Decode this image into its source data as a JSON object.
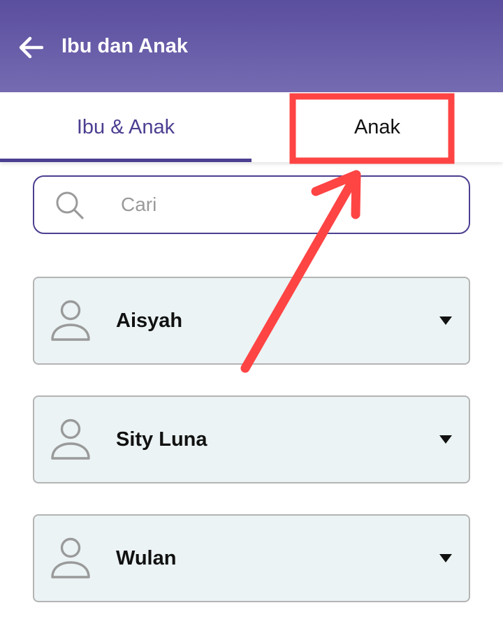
{
  "appbar": {
    "title": "Ibu dan Anak",
    "back_icon": "arrow-left-icon",
    "background": "#5a4e9e",
    "text_color": "#ffffff"
  },
  "tabs": [
    {
      "label": "Ibu & Anak",
      "selected": true
    },
    {
      "label": "Anak",
      "selected": false
    }
  ],
  "search": {
    "placeholder": "Cari",
    "value": "",
    "icon": "search-icon"
  },
  "items": [
    {
      "name": "Aisyah",
      "icon": "person-icon",
      "action_icon": "caret-down-icon"
    },
    {
      "name": "Sity Luna",
      "icon": "person-icon",
      "action_icon": "caret-down-icon"
    },
    {
      "name": "Wulan",
      "icon": "person-icon",
      "action_icon": "caret-down-icon"
    }
  ],
  "colors": {
    "accent": "#4b3f91",
    "card_background": "#ebf3f4",
    "card_border": "#b4b4b4",
    "annotation_red": "#ff4444"
  }
}
